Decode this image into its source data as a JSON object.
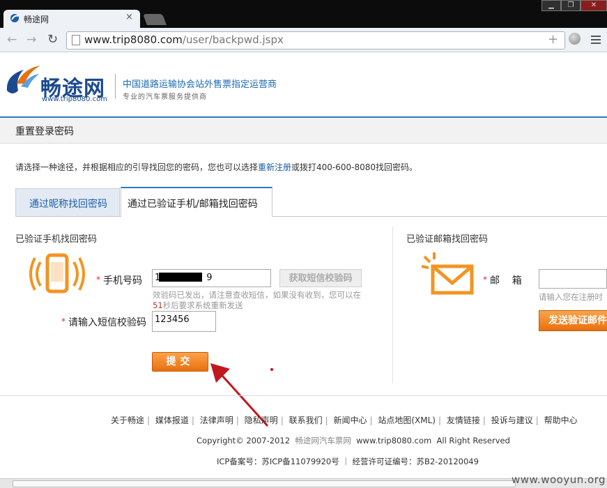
{
  "browser": {
    "tab_title": "畅途网",
    "tab_close": "×",
    "url_host": "www.trip8080.com",
    "url_path": "/user/backpwd.jspx",
    "win_buttons": [
      "▁",
      "❐",
      "✕"
    ]
  },
  "site": {
    "logo_text": "畅途网",
    "logo_url": "www.trip8080.com",
    "slogan_main": "中国道路运输协会站外售票指定运营商",
    "slogan_sub": "专业的汽车票服务提供商"
  },
  "page": {
    "title": "重置登录密码",
    "intro_before": "请选择一种途径，并根据相应的引导找回您的密码，您也可以选择",
    "intro_link": "重新注册",
    "intro_after": "或拨打400-600-8080找回密码。",
    "tabs": [
      "通过昵称找回密码",
      "通过已验证手机/邮箱找回密码"
    ],
    "active_tab": 1
  },
  "phone_panel": {
    "title": "已验证手机找回密码",
    "required_mark": "*",
    "phone_label": "手机号码",
    "phone_value_prefix": "1",
    "phone_value_suffix": "9",
    "sms_button": "获取短信校验码",
    "hint_line1": "效验码已发出，请注意查收短信，如果没有收到，您可以在",
    "countdown": "51",
    "hint_line2": "秒后要求系统重新发送",
    "code_label": "请输入短信校验码",
    "code_value": "123456",
    "submit": "提交"
  },
  "email_panel": {
    "title": "已验证邮箱找回密码",
    "required_mark": "*",
    "email_label": "邮    箱",
    "email_value": "",
    "hint": "请输入您在注册时",
    "send_button": "发送验证邮件"
  },
  "footer": {
    "links": [
      "关于畅途",
      "媒体报道",
      "法律声明",
      "隐私声明",
      "联系我们",
      "新闻中心",
      "站点地图(XML)",
      "友情链接",
      "投诉与建议",
      "帮助中心"
    ],
    "copyright": "Copyright© 2007-2012",
    "copyright_site": "畅途网汽车票网",
    "copyright_url": "www.trip8080.com",
    "rights": "All Right Reserved",
    "icp": "ICP备案号：苏ICP备11079920号 ｜ 经营许可证编号：苏B2-20120049"
  },
  "watermark": "www.wooyun.org",
  "colors": {
    "brand_blue": "#1c4a8f",
    "orange": "#e8700e",
    "accent_red": "#d00000"
  }
}
